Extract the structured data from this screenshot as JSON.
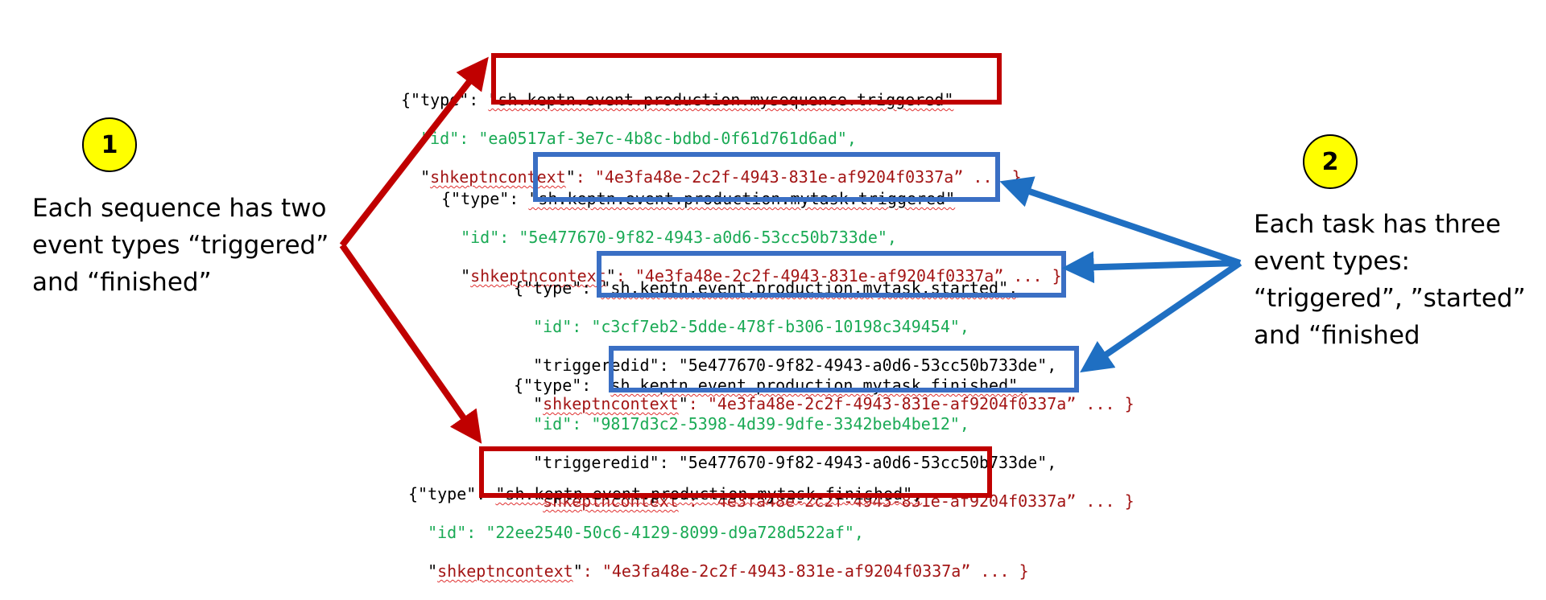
{
  "badges": {
    "left": "1",
    "right": "2"
  },
  "captions": {
    "left": [
      "Each sequence has two",
      "event types “triggered”",
      "and “finished”"
    ],
    "right": [
      "Each task has three",
      "event types:",
      "“triggered”, ”started”",
      "and “finished"
    ]
  },
  "events": [
    {
      "brace": "{\"",
      "type_key": "type",
      "type_value": "\"sh.keptn.event.production.mysequence.triggered\"",
      "id_key": "\"id\":",
      "id_value": " \"ea0517af-3e7c-4b8c-bdbd-0f61d761d6ad\",",
      "ctx_key": "shkeptncontext",
      "ctx_value": ": \"4e3fa48e-2c2f-4943-831e-af9204f0337a” ... }"
    },
    {
      "brace": "{\"",
      "type_key": "type",
      "type_value": "\"sh.keptn.event.production.mytask.triggered\"",
      "id_key": "\"id\":",
      "id_value": " \"5e477670-9f82-4943-a0d6-53cc50b733de\",",
      "ctx_key": "shkeptncontext",
      "ctx_value": ": \"4e3fa48e-2c2f-4943-831e-af9204f0337a” ... }"
    },
    {
      "brace": "{\"",
      "type_key": "type",
      "type_value": "\"sh.keptn.event.production.mytask.started\",",
      "id_key": "\"id\":",
      "id_value": " \"c3cf7eb2-5dde-478f-b306-10198c349454\",",
      "trig_key": "triggeredid",
      "trig_value": ": \"5e477670-9f82-4943-a0d6-53cc50b733de\",",
      "ctx_key": "shkeptncontext",
      "ctx_value": ": \"4e3fa48e-2c2f-4943-831e-af9204f0337a” ... }"
    },
    {
      "brace": "{\"",
      "type_key": "type",
      "type_value": "sh.keptn.event.production.mytask.finished\",",
      "id_key": "\"id\":",
      "id_value": " \"9817d3c2-5398-4d39-9dfe-3342beb4be12\",",
      "trig_key": "triggeredid",
      "trig_value": ": \"5e477670-9f82-4943-a0d6-53cc50b733de\",",
      "ctx_key": "shkeptncontext",
      "ctx_value": ": \"4e3fa48e-2c2f-4943-831e-af9204f0337a” ... }"
    },
    {
      "brace": "{\"",
      "type_key": "type",
      "type_value": "\"sh.keptn.event.production.mytask.finished\",",
      "id_key": "\"id\":",
      "id_value": " \"22ee2540-50c6-4129-8099-d9a728d522af\",",
      "ctx_key": "shkeptncontext",
      "ctx_value": ": \"4e3fa48e-2c2f-4943-831e-af9204f0337a” ... }"
    }
  ],
  "colors": {
    "sequence_box": "#c00000",
    "task_box": "#3a6fc4",
    "badge_fill": "#ffff00",
    "key_red": "#a31515",
    "id_green": "#1aaa55"
  }
}
